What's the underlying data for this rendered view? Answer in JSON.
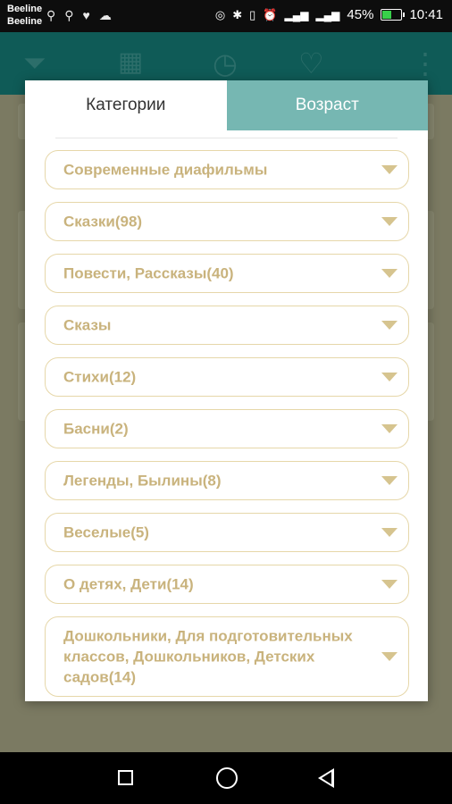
{
  "status_bar": {
    "carrier1": "Beeline",
    "carrier2": "Beeline",
    "battery": "45%",
    "time": "10:41"
  },
  "dialog": {
    "tabs": [
      {
        "label": "Категории",
        "active": true
      },
      {
        "label": "Возраст",
        "active": false
      }
    ],
    "categories": [
      "Современные диафильмы",
      "Сказки(98)",
      "Повести, Рассказы(40)",
      "Сказы",
      "Стихи(12)",
      "Басни(2)",
      "Легенды, Былины(8)",
      "Веселые(5)",
      "О детях, Дети(14)",
      "Дошкольники, Для подготовительных классов, Дошкольников, Детских садов(14)"
    ]
  },
  "colors": {
    "accent": "#76b7b2",
    "appbar": "#0f5b57",
    "category_text": "#c9b37d",
    "category_border": "#e6d7a9"
  }
}
